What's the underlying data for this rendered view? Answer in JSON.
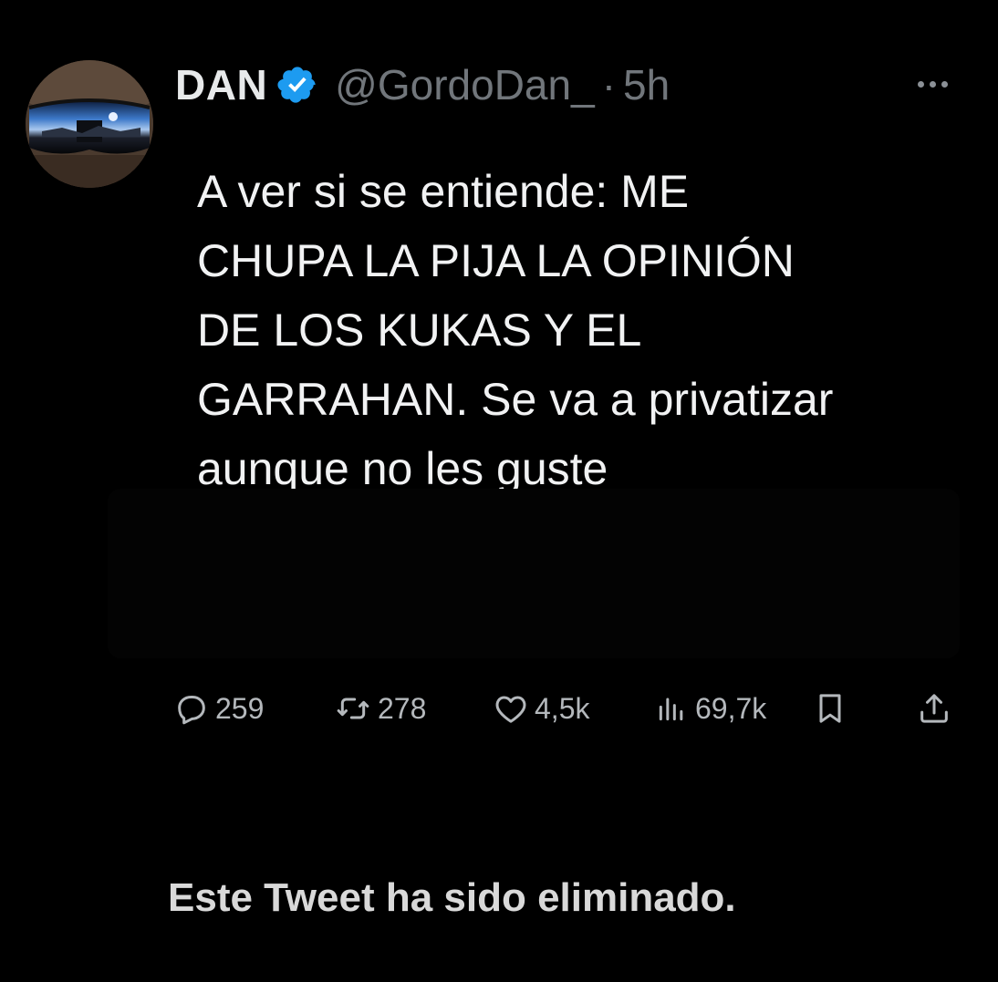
{
  "tweet": {
    "author": {
      "name": "DAN",
      "handle": "@GordoDan_",
      "verified": true
    },
    "separator": "·",
    "time": "5h",
    "text": "A ver si se entiende: ME\nCHUPA LA PIJA LA OPINIÓN\nDE LOS KUKAS Y EL\nGARRAHAN. Se va a privatizar\naunque no les guste",
    "stats": {
      "replies": "259",
      "retweets": "278",
      "likes": "4,5k",
      "views": "69,7k"
    }
  },
  "icons": {
    "more": "more-dots-icon",
    "verified": "verified-badge-icon",
    "reply": "reply-bubble-icon",
    "retweet": "retweet-icon",
    "like": "heart-icon",
    "views": "views-bars-icon",
    "bookmark": "bookmark-icon",
    "share": "share-upload-icon"
  },
  "colors": {
    "background": "#000000",
    "text": "#e7e9ea",
    "muted": "#71767b",
    "verified": "#1d9bf0"
  },
  "notice": "Este Tweet ha sido eliminado."
}
